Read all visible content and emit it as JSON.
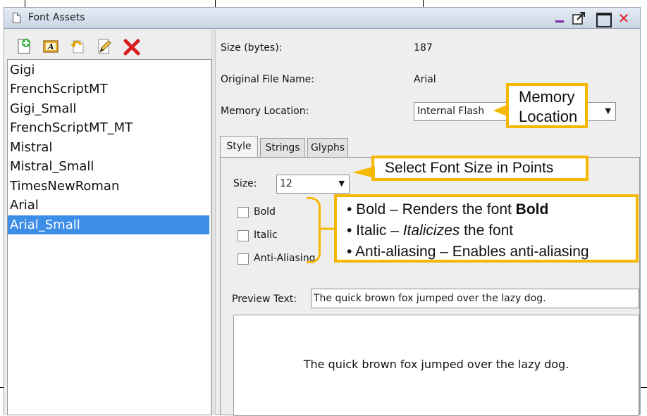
{
  "window": {
    "title": "Font Assets"
  },
  "toolbar": {
    "icons": [
      "add-icon",
      "font-icon",
      "undo-icon",
      "edit-icon",
      "delete-icon"
    ]
  },
  "font_list": {
    "items": [
      "Gigi",
      "FrenchScriptMT",
      "Gigi_Small",
      "FrenchScriptMT_MT",
      "Mistral",
      "Mistral_Small",
      "TimesNewRoman",
      "Arial",
      "Arial_Small"
    ],
    "selected": "Arial_Small"
  },
  "details": {
    "size_label": "Size (bytes):",
    "size_value": "187",
    "file_name_label": "Original File Name:",
    "file_name_value": "Arial",
    "memory_label": "Memory Location:",
    "memory_value": "Internal Flash"
  },
  "tabs": [
    "Style",
    "Strings",
    "Glyphs"
  ],
  "style": {
    "size_label": "Size:",
    "size_value": "12",
    "bold_label": "Bold",
    "italic_label": "Italic",
    "antialias_label": "Anti-Aliasing",
    "preview_label": "Preview Text:",
    "preview_value": "The quick brown fox jumped over the lazy dog.",
    "preview_render": "The quick brown fox jumped over the lazy dog."
  },
  "callouts": {
    "memory_line1": "Memory",
    "memory_line2": "Location",
    "font_size": "Select Font Size in Points",
    "bold_prefix": "• Bold – Renders the font ",
    "bold_word": "Bold",
    "italic_prefix": "• Italic – ",
    "italic_word": "Italicizes",
    "italic_suffix": " the font",
    "antialias": "• Anti-aliasing – Enables anti-aliasing"
  },
  "colors": {
    "accent": "#f5b800",
    "selection": "#3d8ee8",
    "close": "#e02020"
  }
}
